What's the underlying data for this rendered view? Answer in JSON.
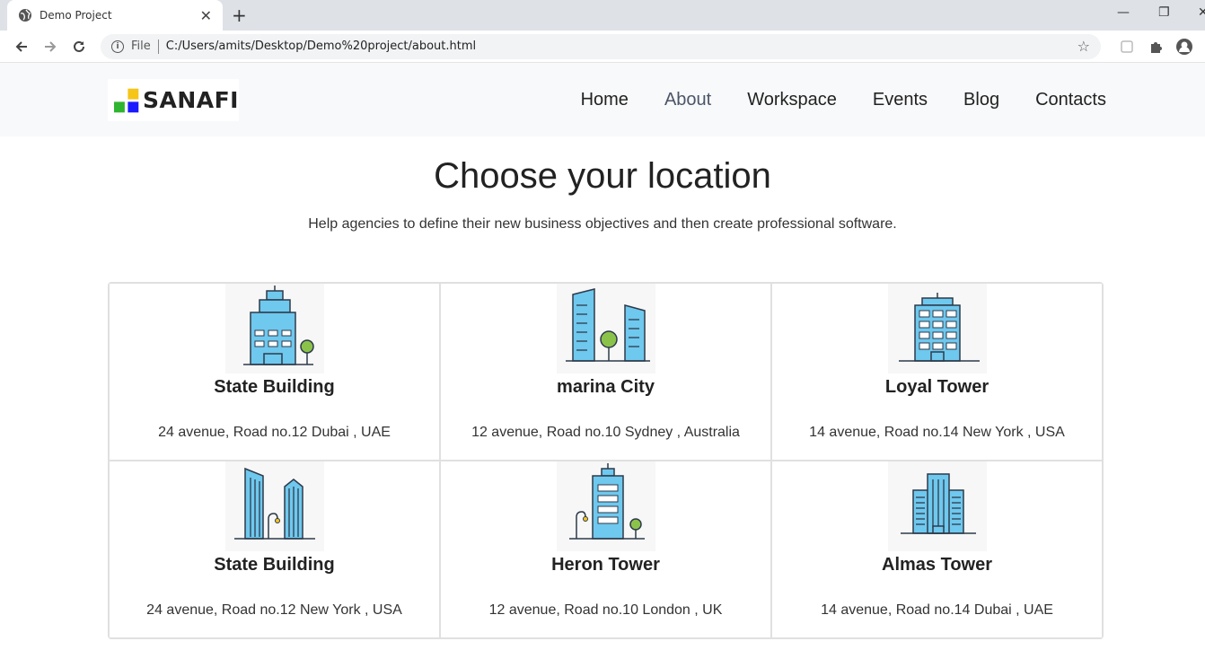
{
  "browser": {
    "tab_title": "Demo Project",
    "tab_close": "✕",
    "new_tab": "+",
    "scheme_label": "File",
    "url": "C:/Users/amits/Desktop/Demo%20project/about.html",
    "window_controls": [
      "—",
      "❐",
      "✕"
    ]
  },
  "site": {
    "logo_text": "SANAFI",
    "nav": [
      {
        "label": "Home"
      },
      {
        "label": "About",
        "active": true
      },
      {
        "label": "Workspace"
      },
      {
        "label": "Events"
      },
      {
        "label": "Blog"
      },
      {
        "label": "Contacts"
      }
    ]
  },
  "main": {
    "title": "Choose your location",
    "subtitle": "Help agencies to define their new business objectives and then create professional software.",
    "locations": [
      {
        "name": "State Building",
        "address": "24 avenue, Road no.12 Dubai , UAE",
        "icon": "office-building-icon"
      },
      {
        "name": "marina City",
        "address": "12 avenue, Road no.10 Sydney , Australia",
        "icon": "twin-towers-icon"
      },
      {
        "name": "Loyal Tower",
        "address": "14 avenue, Road no.14 New York , USA",
        "icon": "tower-building-icon"
      },
      {
        "name": "State Building",
        "address": "24 avenue, Road no.12 New York , USA",
        "icon": "skyscrapers-icon"
      },
      {
        "name": "Heron Tower",
        "address": "12 avenue, Road no.10 London , UK",
        "icon": "tall-tower-icon"
      },
      {
        "name": "Almas Tower",
        "address": "14 avenue, Road no.14 Dubai , UAE",
        "icon": "glass-tower-icon"
      }
    ]
  },
  "colors": {
    "building_blue": "#6fc8ee",
    "outline": "#2d3a4a",
    "tree_green": "#8bc34a",
    "logo_yellow": "#f5c518",
    "logo_green": "#2fb52f",
    "logo_blue": "#1a1aff"
  }
}
